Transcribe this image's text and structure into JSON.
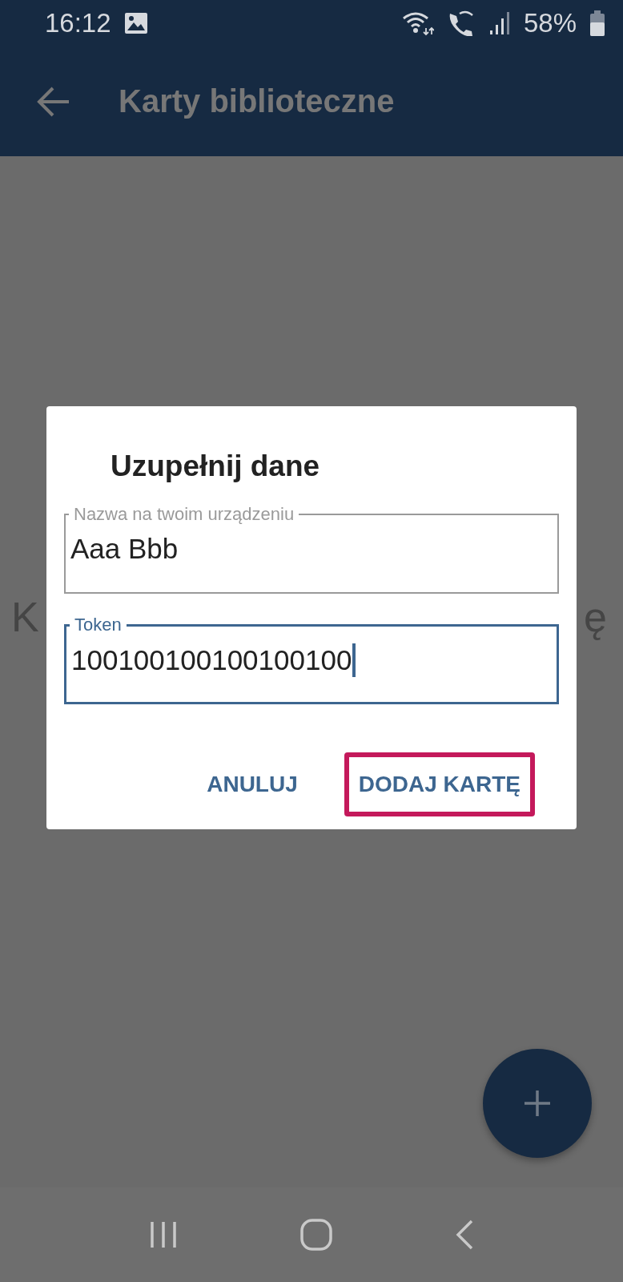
{
  "status_bar": {
    "time": "16:12",
    "battery": "58%"
  },
  "app_bar": {
    "title": "Karty biblioteczne"
  },
  "background_text": [
    "K",
    "ę"
  ],
  "dialog": {
    "title": "Uzupełnij dane",
    "fields": [
      {
        "label": "Nazwa na twoim urządzeniu",
        "value": "Aaa Bbb",
        "focused": false
      },
      {
        "label": "Token",
        "value": "100100100100100100",
        "focused": true
      }
    ],
    "buttons": [
      {
        "label": "ANULUJ",
        "highlighted": false
      },
      {
        "label": "DODAJ KARTĘ",
        "highlighted": true
      }
    ]
  }
}
